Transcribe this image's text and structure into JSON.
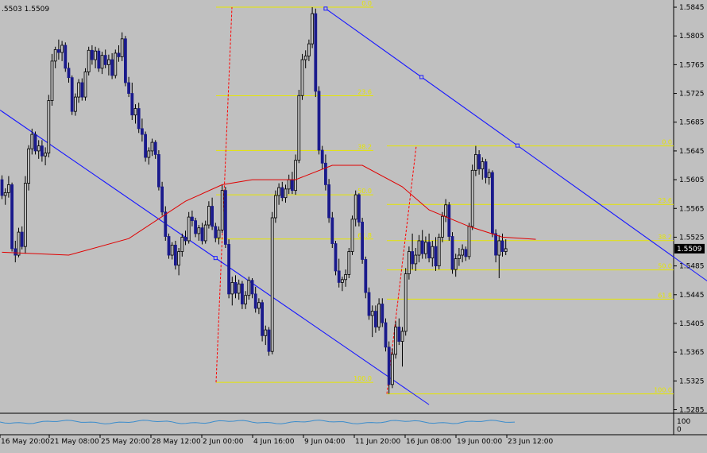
{
  "header": {
    "quote": ".5503 1.5509"
  },
  "colors": {
    "background": "#c0c0c0",
    "candle": "#000000",
    "volume_bar": "#1a1a8c",
    "fibo": "#e6e600",
    "trendline": "#1c1cff",
    "ma": "#e00000",
    "fibo_span": "#ff0000",
    "indicator": "#3a8ccc",
    "price_tag_bg": "#000000",
    "price_tag_fg": "#ffffff"
  },
  "chart_data": {
    "type": "candlestick",
    "symbol_display": ".5503 1.5509",
    "price_axis_ticks": [
      "1.5845",
      "1.5805",
      "1.5765",
      "1.5725",
      "1.5685",
      "1.5645",
      "1.5605",
      "1.5565",
      "1.5525",
      "1.5485",
      "1.5445",
      "1.5405",
      "1.5365",
      "1.5325",
      "1.5285"
    ],
    "time_axis_ticks": [
      "16 May 20:00",
      "21 May 08:00",
      "25 May 20:00",
      "28 May 12:00",
      "2 Jun 00:00",
      "4 Jun 16:00",
      "9 Jun 04:00",
      "11 Jun 20:00",
      "16 Jun 08:00",
      "19 Jun 00:00",
      "23 Jun 12:00"
    ],
    "current_price": "1.5509",
    "ylim": [
      1.528,
      1.5855
    ],
    "fibonacci_sets": [
      {
        "high": 1.5845,
        "low": 1.5323,
        "levels": [
          {
            "ratio": 0.0,
            "label": "0.0"
          },
          {
            "ratio": 0.236,
            "label": "23.6"
          },
          {
            "ratio": 0.382,
            "label": "38.2"
          },
          {
            "ratio": 0.5,
            "label": "50.0"
          },
          {
            "ratio": 0.618,
            "label": "61.8"
          },
          {
            "ratio": 1.0,
            "label": "100.0"
          }
        ]
      },
      {
        "high": 1.5652,
        "low": 1.5307,
        "levels": [
          {
            "ratio": 0.0,
            "label": "0.0"
          },
          {
            "ratio": 0.236,
            "label": "23.6"
          },
          {
            "ratio": 0.382,
            "label": "38.2"
          },
          {
            "ratio": 0.5,
            "label": "50.0"
          },
          {
            "ratio": 0.618,
            "label": "61.8"
          },
          {
            "ratio": 1.0,
            "label": "100.0"
          }
        ]
      }
    ],
    "trendlines": [
      {
        "from": {
          "bar": 0,
          "price": 1.57
        },
        "to": {
          "bar": 128,
          "price": 1.5292
        }
      },
      {
        "from": {
          "bar": 97,
          "price": 1.5843
        },
        "to": {
          "bar": 212,
          "price": 1.5462
        }
      }
    ],
    "ma_path": [
      [
        0,
        1.5504
      ],
      [
        20,
        1.55
      ],
      [
        38,
        1.5523
      ],
      [
        55,
        1.5575
      ],
      [
        66,
        1.5598
      ],
      [
        75,
        1.5605
      ],
      [
        88,
        1.5605
      ],
      [
        99,
        1.5625
      ],
      [
        108,
        1.5625
      ],
      [
        120,
        1.5595
      ],
      [
        128,
        1.5563
      ],
      [
        140,
        1.554
      ],
      [
        150,
        1.5525
      ],
      [
        160,
        1.5522
      ]
    ],
    "candles": [
      {
        "o": 1.5605,
        "h": 1.5611,
        "l": 1.5578,
        "c": 1.5583
      },
      {
        "o": 1.5583,
        "h": 1.5593,
        "l": 1.557,
        "c": 1.5587
      },
      {
        "o": 1.5587,
        "h": 1.561,
        "l": 1.558,
        "c": 1.5598
      },
      {
        "o": 1.5598,
        "h": 1.5601,
        "l": 1.5505,
        "c": 1.5509
      },
      {
        "o": 1.5509,
        "h": 1.552,
        "l": 1.549,
        "c": 1.55
      },
      {
        "o": 1.55,
        "h": 1.5538,
        "l": 1.5497,
        "c": 1.5532
      },
      {
        "o": 1.5532,
        "h": 1.554,
        "l": 1.5508,
        "c": 1.5512
      },
      {
        "o": 1.5512,
        "h": 1.561,
        "l": 1.5502,
        "c": 1.56
      },
      {
        "o": 1.56,
        "h": 1.5653,
        "l": 1.559,
        "c": 1.5648
      },
      {
        "o": 1.5648,
        "h": 1.5676,
        "l": 1.564,
        "c": 1.5668
      },
      {
        "o": 1.5668,
        "h": 1.5672,
        "l": 1.564,
        "c": 1.5645
      },
      {
        "o": 1.5645,
        "h": 1.566,
        "l": 1.5634,
        "c": 1.5652
      },
      {
        "o": 1.5652,
        "h": 1.566,
        "l": 1.563,
        "c": 1.5638
      },
      {
        "o": 1.5638,
        "h": 1.565,
        "l": 1.5625,
        "c": 1.5642
      },
      {
        "o": 1.5642,
        "h": 1.5723,
        "l": 1.5636,
        "c": 1.5715
      },
      {
        "o": 1.5715,
        "h": 1.578,
        "l": 1.5708,
        "c": 1.577
      },
      {
        "o": 1.577,
        "h": 1.579,
        "l": 1.576,
        "c": 1.5786
      },
      {
        "o": 1.5786,
        "h": 1.58,
        "l": 1.5772,
        "c": 1.5782
      },
      {
        "o": 1.5782,
        "h": 1.5798,
        "l": 1.577,
        "c": 1.5792
      },
      {
        "o": 1.5792,
        "h": 1.5796,
        "l": 1.5755,
        "c": 1.576
      },
      {
        "o": 1.576,
        "h": 1.5768,
        "l": 1.574,
        "c": 1.5747
      },
      {
        "o": 1.5747,
        "h": 1.575,
        "l": 1.5695,
        "c": 1.57
      },
      {
        "o": 1.57,
        "h": 1.5725,
        "l": 1.5694,
        "c": 1.572
      },
      {
        "o": 1.572,
        "h": 1.5745,
        "l": 1.5712,
        "c": 1.574
      },
      {
        "o": 1.574,
        "h": 1.5746,
        "l": 1.5715,
        "c": 1.572
      },
      {
        "o": 1.572,
        "h": 1.576,
        "l": 1.5715,
        "c": 1.5755
      },
      {
        "o": 1.5755,
        "h": 1.579,
        "l": 1.575,
        "c": 1.5785
      },
      {
        "o": 1.5785,
        "h": 1.5792,
        "l": 1.5765,
        "c": 1.5772
      },
      {
        "o": 1.5772,
        "h": 1.579,
        "l": 1.576,
        "c": 1.5784
      },
      {
        "o": 1.5784,
        "h": 1.5788,
        "l": 1.5755,
        "c": 1.576
      },
      {
        "o": 1.576,
        "h": 1.5783,
        "l": 1.5752,
        "c": 1.5778
      },
      {
        "o": 1.5778,
        "h": 1.5786,
        "l": 1.576,
        "c": 1.5765
      },
      {
        "o": 1.5765,
        "h": 1.5779,
        "l": 1.575,
        "c": 1.5772
      },
      {
        "o": 1.5772,
        "h": 1.5781,
        "l": 1.5745,
        "c": 1.575
      },
      {
        "o": 1.575,
        "h": 1.5786,
        "l": 1.5746,
        "c": 1.5781
      },
      {
        "o": 1.5781,
        "h": 1.5792,
        "l": 1.5769,
        "c": 1.5776
      },
      {
        "o": 1.5776,
        "h": 1.581,
        "l": 1.577,
        "c": 1.5801
      },
      {
        "o": 1.5801,
        "h": 1.5805,
        "l": 1.5735,
        "c": 1.574
      },
      {
        "o": 1.574,
        "h": 1.5748,
        "l": 1.572,
        "c": 1.5725
      },
      {
        "o": 1.5725,
        "h": 1.574,
        "l": 1.5688,
        "c": 1.5695
      },
      {
        "o": 1.5695,
        "h": 1.571,
        "l": 1.5683,
        "c": 1.5704
      },
      {
        "o": 1.5704,
        "h": 1.5712,
        "l": 1.567,
        "c": 1.5676
      },
      {
        "o": 1.5676,
        "h": 1.569,
        "l": 1.5658,
        "c": 1.5668
      },
      {
        "o": 1.5668,
        "h": 1.5672,
        "l": 1.563,
        "c": 1.5636
      },
      {
        "o": 1.5636,
        "h": 1.565,
        "l": 1.5626,
        "c": 1.5645
      },
      {
        "o": 1.5645,
        "h": 1.5662,
        "l": 1.5638,
        "c": 1.5657
      },
      {
        "o": 1.5657,
        "h": 1.566,
        "l": 1.5634,
        "c": 1.564
      },
      {
        "o": 1.564,
        "h": 1.5646,
        "l": 1.559,
        "c": 1.5595
      },
      {
        "o": 1.5595,
        "h": 1.5602,
        "l": 1.5555,
        "c": 1.556
      },
      {
        "o": 1.556,
        "h": 1.5568,
        "l": 1.552,
        "c": 1.5526
      },
      {
        "o": 1.5526,
        "h": 1.553,
        "l": 1.5495,
        "c": 1.55
      },
      {
        "o": 1.55,
        "h": 1.5518,
        "l": 1.5494,
        "c": 1.5514
      },
      {
        "o": 1.5514,
        "h": 1.552,
        "l": 1.548,
        "c": 1.5486
      },
      {
        "o": 1.5486,
        "h": 1.551,
        "l": 1.5472,
        "c": 1.5505
      },
      {
        "o": 1.5505,
        "h": 1.553,
        "l": 1.5498,
        "c": 1.5525
      },
      {
        "o": 1.5525,
        "h": 1.5534,
        "l": 1.5514,
        "c": 1.552
      },
      {
        "o": 1.552,
        "h": 1.556,
        "l": 1.5516,
        "c": 1.5553
      },
      {
        "o": 1.5553,
        "h": 1.5562,
        "l": 1.554,
        "c": 1.5548
      },
      {
        "o": 1.5548,
        "h": 1.5552,
        "l": 1.5525,
        "c": 1.553
      },
      {
        "o": 1.553,
        "h": 1.5542,
        "l": 1.552,
        "c": 1.5538
      },
      {
        "o": 1.5538,
        "h": 1.5545,
        "l": 1.5515,
        "c": 1.552
      },
      {
        "o": 1.552,
        "h": 1.5548,
        "l": 1.5516,
        "c": 1.5542
      },
      {
        "o": 1.5542,
        "h": 1.5575,
        "l": 1.5537,
        "c": 1.5568
      },
      {
        "o": 1.5568,
        "h": 1.558,
        "l": 1.5535,
        "c": 1.554
      },
      {
        "o": 1.554,
        "h": 1.5545,
        "l": 1.5518,
        "c": 1.5524
      },
      {
        "o": 1.5524,
        "h": 1.554,
        "l": 1.5515,
        "c": 1.5535
      },
      {
        "o": 1.5535,
        "h": 1.5598,
        "l": 1.5531,
        "c": 1.559
      },
      {
        "o": 1.559,
        "h": 1.5595,
        "l": 1.551,
        "c": 1.5515
      },
      {
        "o": 1.5515,
        "h": 1.5522,
        "l": 1.544,
        "c": 1.5446
      },
      {
        "o": 1.5446,
        "h": 1.547,
        "l": 1.543,
        "c": 1.5462
      },
      {
        "o": 1.5462,
        "h": 1.5472,
        "l": 1.544,
        "c": 1.5447
      },
      {
        "o": 1.5447,
        "h": 1.5466,
        "l": 1.5438,
        "c": 1.546
      },
      {
        "o": 1.546,
        "h": 1.5464,
        "l": 1.5425,
        "c": 1.5432
      },
      {
        "o": 1.5432,
        "h": 1.545,
        "l": 1.5425,
        "c": 1.5444
      },
      {
        "o": 1.5444,
        "h": 1.547,
        "l": 1.5438,
        "c": 1.5465
      },
      {
        "o": 1.5465,
        "h": 1.5468,
        "l": 1.544,
        "c": 1.5446
      },
      {
        "o": 1.5446,
        "h": 1.5456,
        "l": 1.542,
        "c": 1.5426
      },
      {
        "o": 1.5426,
        "h": 1.544,
        "l": 1.5418,
        "c": 1.5434
      },
      {
        "o": 1.5434,
        "h": 1.5438,
        "l": 1.538,
        "c": 1.5388
      },
      {
        "o": 1.5388,
        "h": 1.5402,
        "l": 1.5375,
        "c": 1.5396
      },
      {
        "o": 1.5396,
        "h": 1.54,
        "l": 1.536,
        "c": 1.5366
      },
      {
        "o": 1.5366,
        "h": 1.556,
        "l": 1.5362,
        "c": 1.5552
      },
      {
        "o": 1.5552,
        "h": 1.559,
        "l": 1.5545,
        "c": 1.5583
      },
      {
        "o": 1.5583,
        "h": 1.56,
        "l": 1.557,
        "c": 1.5594
      },
      {
        "o": 1.5594,
        "h": 1.5602,
        "l": 1.5575,
        "c": 1.558
      },
      {
        "o": 1.558,
        "h": 1.5598,
        "l": 1.5573,
        "c": 1.5592
      },
      {
        "o": 1.5592,
        "h": 1.5612,
        "l": 1.5585,
        "c": 1.5605
      },
      {
        "o": 1.5605,
        "h": 1.5616,
        "l": 1.5585,
        "c": 1.559
      },
      {
        "o": 1.559,
        "h": 1.564,
        "l": 1.5584,
        "c": 1.5632
      },
      {
        "o": 1.5632,
        "h": 1.573,
        "l": 1.5628,
        "c": 1.5722
      },
      {
        "o": 1.5722,
        "h": 1.578,
        "l": 1.5716,
        "c": 1.5772
      },
      {
        "o": 1.5772,
        "h": 1.5785,
        "l": 1.576,
        "c": 1.5777
      },
      {
        "o": 1.5777,
        "h": 1.58,
        "l": 1.577,
        "c": 1.5794
      },
      {
        "o": 1.5794,
        "h": 1.5845,
        "l": 1.5788,
        "c": 1.5836
      },
      {
        "o": 1.5836,
        "h": 1.5843,
        "l": 1.572,
        "c": 1.5728
      },
      {
        "o": 1.5728,
        "h": 1.5735,
        "l": 1.564,
        "c": 1.5646
      },
      {
        "o": 1.5646,
        "h": 1.5652,
        "l": 1.562,
        "c": 1.5628
      },
      {
        "o": 1.5628,
        "h": 1.564,
        "l": 1.559,
        "c": 1.5598
      },
      {
        "o": 1.5598,
        "h": 1.5606,
        "l": 1.5545,
        "c": 1.5552
      },
      {
        "o": 1.5552,
        "h": 1.556,
        "l": 1.551,
        "c": 1.5516
      },
      {
        "o": 1.5516,
        "h": 1.552,
        "l": 1.5472,
        "c": 1.5478
      },
      {
        "o": 1.5478,
        "h": 1.5495,
        "l": 1.5455,
        "c": 1.5462
      },
      {
        "o": 1.5462,
        "h": 1.547,
        "l": 1.545,
        "c": 1.5466
      },
      {
        "o": 1.5466,
        "h": 1.548,
        "l": 1.5456,
        "c": 1.5473
      },
      {
        "o": 1.5473,
        "h": 1.551,
        "l": 1.5468,
        "c": 1.5505
      },
      {
        "o": 1.5505,
        "h": 1.5555,
        "l": 1.55,
        "c": 1.555
      },
      {
        "o": 1.555,
        "h": 1.559,
        "l": 1.554,
        "c": 1.5584
      },
      {
        "o": 1.5584,
        "h": 1.5586,
        "l": 1.554,
        "c": 1.5546
      },
      {
        "o": 1.5546,
        "h": 1.5552,
        "l": 1.5488,
        "c": 1.5494
      },
      {
        "o": 1.5494,
        "h": 1.5498,
        "l": 1.544,
        "c": 1.5448
      },
      {
        "o": 1.5448,
        "h": 1.5455,
        "l": 1.541,
        "c": 1.5416
      },
      {
        "o": 1.5416,
        "h": 1.543,
        "l": 1.5386,
        "c": 1.5422
      },
      {
        "o": 1.5422,
        "h": 1.543,
        "l": 1.5392,
        "c": 1.54
      },
      {
        "o": 1.54,
        "h": 1.544,
        "l": 1.5395,
        "c": 1.5432
      },
      {
        "o": 1.5432,
        "h": 1.544,
        "l": 1.54,
        "c": 1.5406
      },
      {
        "o": 1.5406,
        "h": 1.5412,
        "l": 1.5366,
        "c": 1.5372
      },
      {
        "o": 1.5372,
        "h": 1.538,
        "l": 1.5307,
        "c": 1.532
      },
      {
        "o": 1.532,
        "h": 1.537,
        "l": 1.5315,
        "c": 1.5362
      },
      {
        "o": 1.5362,
        "h": 1.5408,
        "l": 1.5356,
        "c": 1.54
      },
      {
        "o": 1.54,
        "h": 1.5412,
        "l": 1.5375,
        "c": 1.538
      },
      {
        "o": 1.538,
        "h": 1.54,
        "l": 1.5345,
        "c": 1.5394
      },
      {
        "o": 1.5394,
        "h": 1.5482,
        "l": 1.5388,
        "c": 1.5474
      },
      {
        "o": 1.5474,
        "h": 1.5512,
        "l": 1.5466,
        "c": 1.5505
      },
      {
        "o": 1.5505,
        "h": 1.553,
        "l": 1.548,
        "c": 1.5488
      },
      {
        "o": 1.5488,
        "h": 1.551,
        "l": 1.5478,
        "c": 1.55
      },
      {
        "o": 1.55,
        "h": 1.5528,
        "l": 1.549,
        "c": 1.552
      },
      {
        "o": 1.552,
        "h": 1.5535,
        "l": 1.5495,
        "c": 1.5502
      },
      {
        "o": 1.5502,
        "h": 1.5526,
        "l": 1.5495,
        "c": 1.5518
      },
      {
        "o": 1.5518,
        "h": 1.553,
        "l": 1.549,
        "c": 1.5496
      },
      {
        "o": 1.5496,
        "h": 1.552,
        "l": 1.5484,
        "c": 1.5512
      },
      {
        "o": 1.5512,
        "h": 1.5525,
        "l": 1.5478,
        "c": 1.5485
      },
      {
        "o": 1.5485,
        "h": 1.553,
        "l": 1.548,
        "c": 1.5525
      },
      {
        "o": 1.5525,
        "h": 1.556,
        "l": 1.5518,
        "c": 1.5554
      },
      {
        "o": 1.5554,
        "h": 1.5578,
        "l": 1.5546,
        "c": 1.557
      },
      {
        "o": 1.557,
        "h": 1.5574,
        "l": 1.552,
        "c": 1.5526
      },
      {
        "o": 1.5526,
        "h": 1.5532,
        "l": 1.5474,
        "c": 1.548
      },
      {
        "o": 1.548,
        "h": 1.5502,
        "l": 1.547,
        "c": 1.5495
      },
      {
        "o": 1.5495,
        "h": 1.551,
        "l": 1.5485,
        "c": 1.55
      },
      {
        "o": 1.55,
        "h": 1.5515,
        "l": 1.549,
        "c": 1.5508
      },
      {
        "o": 1.5508,
        "h": 1.5512,
        "l": 1.5492,
        "c": 1.5498
      },
      {
        "o": 1.5498,
        "h": 1.5545,
        "l": 1.5494,
        "c": 1.554
      },
      {
        "o": 1.554,
        "h": 1.5626,
        "l": 1.5535,
        "c": 1.5618
      },
      {
        "o": 1.5618,
        "h": 1.5652,
        "l": 1.561,
        "c": 1.564
      },
      {
        "o": 1.564,
        "h": 1.5646,
        "l": 1.5612,
        "c": 1.562
      },
      {
        "o": 1.562,
        "h": 1.5636,
        "l": 1.5605,
        "c": 1.563
      },
      {
        "o": 1.563,
        "h": 1.5634,
        "l": 1.56,
        "c": 1.5608
      },
      {
        "o": 1.5608,
        "h": 1.562,
        "l": 1.5598,
        "c": 1.5615
      },
      {
        "o": 1.5615,
        "h": 1.5618,
        "l": 1.5525,
        "c": 1.553
      },
      {
        "o": 1.553,
        "h": 1.5536,
        "l": 1.549,
        "c": 1.55
      },
      {
        "o": 1.55,
        "h": 1.5528,
        "l": 1.5468,
        "c": 1.552
      },
      {
        "o": 1.552,
        "h": 1.553,
        "l": 1.5498,
        "c": 1.5505
      },
      {
        "o": 1.5505,
        "h": 1.5522,
        "l": 1.55,
        "c": 1.5509
      }
    ]
  }
}
